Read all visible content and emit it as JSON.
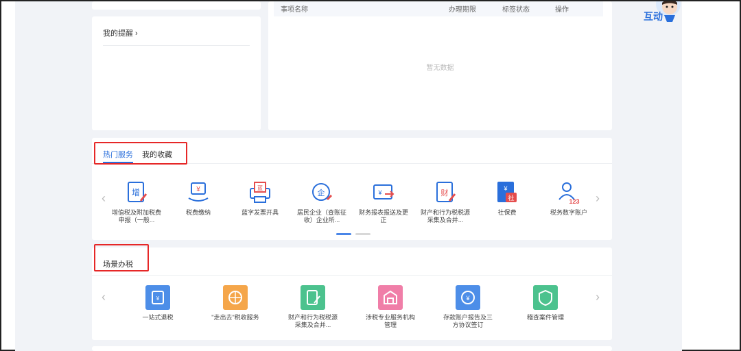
{
  "reminder": {
    "title": "我的提醒 ›"
  },
  "tasks": {
    "columns": [
      "事项名称",
      "办理期限",
      "标签状态",
      "操作"
    ],
    "empty_text": "暂无数据"
  },
  "hot_services": {
    "tabs": [
      "热门服务",
      "我的收藏"
    ],
    "items": [
      {
        "label": "增值税及附加税费申报（一般...",
        "icon": "vat-declare-icon",
        "glyph": "增"
      },
      {
        "label": "税费缴纳",
        "icon": "tax-payment-icon",
        "glyph": "¥"
      },
      {
        "label": "蓝字发票开具",
        "icon": "invoice-print-icon",
        "glyph": "蓝"
      },
      {
        "label": "居民企业（查账征收）企业所...",
        "icon": "enterprise-tax-icon",
        "glyph": "企"
      },
      {
        "label": "财务报表报送及更正",
        "icon": "financial-report-icon",
        "glyph": "¥"
      },
      {
        "label": "财产和行为税税源采集及合并...",
        "icon": "property-tax-icon",
        "glyph": "财"
      },
      {
        "label": "社保费",
        "icon": "social-insurance-icon",
        "glyph": "社"
      },
      {
        "label": "税务数字账户",
        "icon": "digital-account-icon",
        "glyph": "123"
      }
    ],
    "carousel_colors": [
      "#4a86e8",
      "#d8d8d8"
    ]
  },
  "scenes": {
    "title": "场景办税",
    "items": [
      {
        "label": "一站式退税",
        "icon": "refund-icon",
        "color": "#4d8ee8"
      },
      {
        "label": "\"走出去\"税收服务",
        "icon": "go-global-icon",
        "color": "#f5a64a"
      },
      {
        "label": "财产和行为税税源采集及合并...",
        "icon": "property-collect-icon",
        "color": "#4cc28e"
      },
      {
        "label": "涉税专业服务机构管理",
        "icon": "agency-icon",
        "color": "#f07ea8"
      },
      {
        "label": "存款账户报告及三方协议签订",
        "icon": "deposit-account-icon",
        "color": "#4d8ee8"
      },
      {
        "label": "稽查案件管理",
        "icon": "inspection-icon",
        "color": "#4cc28e"
      }
    ]
  },
  "assistant": {
    "label": "互动"
  },
  "colors": {
    "accent": "#2a6fdb",
    "highlight_box": "#e62727"
  }
}
